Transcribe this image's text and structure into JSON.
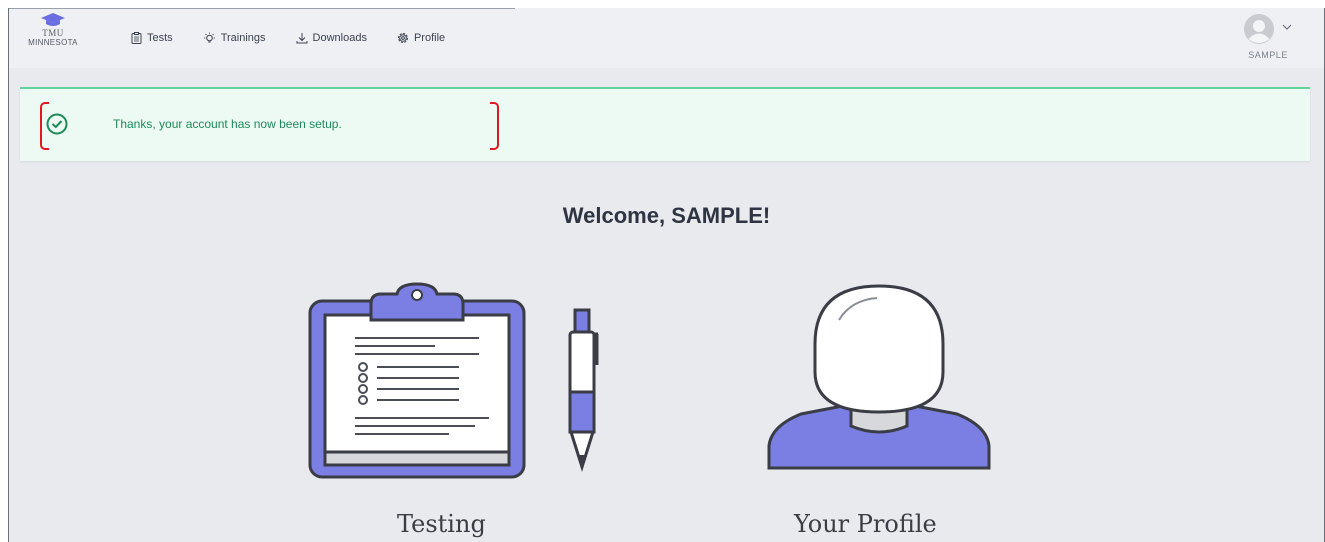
{
  "brand": {
    "line1": "TMU",
    "line2": "MINNESOTA"
  },
  "nav": {
    "items": [
      {
        "label": "Tests",
        "icon": "clipboard-icon"
      },
      {
        "label": "Trainings",
        "icon": "lightbulb-icon"
      },
      {
        "label": "Downloads",
        "icon": "download-icon"
      },
      {
        "label": "Profile",
        "icon": "gear-icon"
      }
    ]
  },
  "user": {
    "name": "SAMPLE",
    "icon": "avatar-icon"
  },
  "alert": {
    "message": "Thanks, your account has now been setup.",
    "icon": "check-circle-icon",
    "color": "#1d8a5a"
  },
  "welcome": "Welcome, SAMPLE!",
  "cards": {
    "testing": {
      "label": "Testing"
    },
    "profile": {
      "label": "Your Profile"
    }
  },
  "colors": {
    "accent": "#7b7fe3",
    "success": "#5fd39d",
    "annotation": "#e0191c"
  }
}
